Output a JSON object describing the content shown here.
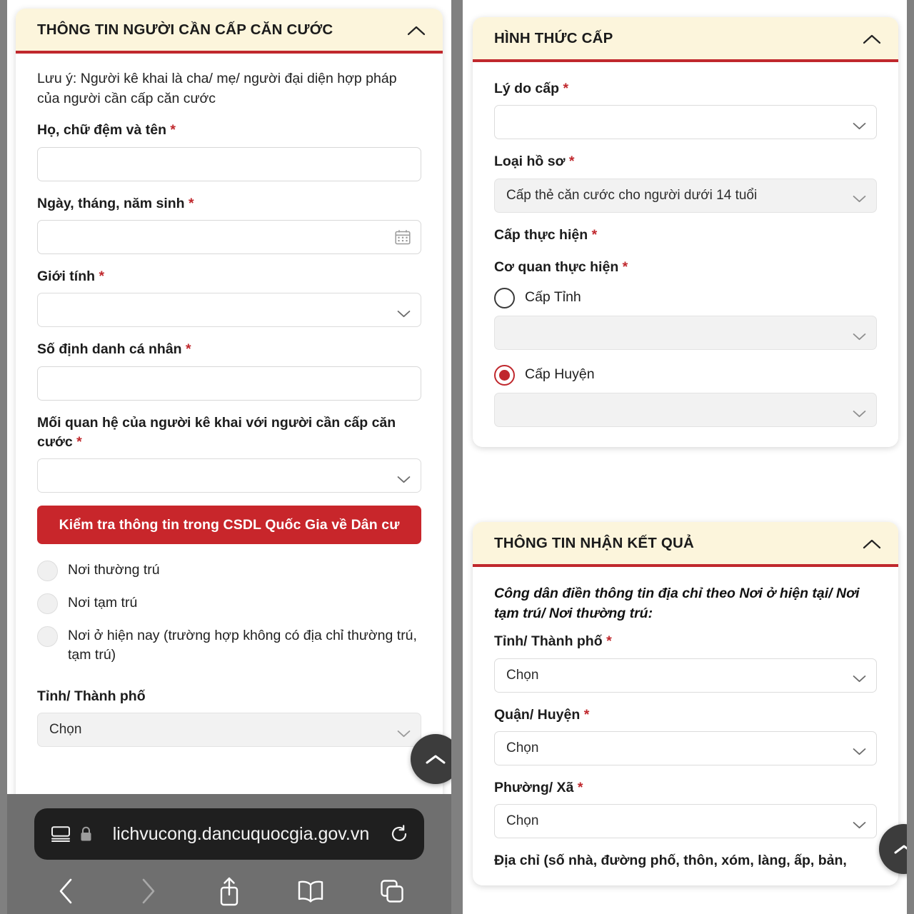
{
  "app": {
    "url": "lichvucong.dancuquocgia.gov.vn",
    "accent_red": "#c0282d",
    "header_cream": "#fcf5dc"
  },
  "left_pane": {
    "card": {
      "title": "THÔNG TIN NGƯỜI CẦN CẤP CĂN CƯỚC",
      "collapse_icon": "chevron-up-icon",
      "note": "Lưu ý: Người kê khai là cha/ mẹ/ người đại diện hợp pháp của người cần cấp căn cước",
      "fields": [
        {
          "label": "Họ, chữ đệm và tên",
          "required": "*",
          "type": "text",
          "value": ""
        },
        {
          "label": "Ngày, tháng, năm sinh",
          "required": "*",
          "type": "date",
          "value": "",
          "icon": "calendar-icon"
        },
        {
          "label": "Giới tính",
          "required": "*",
          "type": "select",
          "value": ""
        },
        {
          "label": "Số định danh cá nhân",
          "required": "*",
          "type": "text",
          "value": ""
        },
        {
          "label": "Mối quan hệ của người kê khai với người cần cấp căn cước",
          "required": "*",
          "type": "select",
          "value": ""
        }
      ],
      "check_button": "Kiểm tra thông tin trong CSDL Quốc Gia về Dân cư",
      "residence_options": [
        {
          "label": "Nơi thường trú",
          "checked": false
        },
        {
          "label": "Nơi tạm trú",
          "checked": false
        },
        {
          "label": "Nơi ở hiện nay (trường hợp không có địa chỉ thường trú, tạm trú)",
          "checked": false
        }
      ],
      "province": {
        "label": "Tỉnh/ Thành phố",
        "required": "",
        "value": "Chọn"
      }
    },
    "fab": {
      "icon": "chevron-up-icon",
      "name": "scroll-to-top"
    }
  },
  "right_pane": {
    "card_issue": {
      "title": "HÌNH THỨC CẤP",
      "collapse_icon": "chevron-up-icon",
      "reason": {
        "label": "Lý do cấp",
        "required": "*",
        "value": ""
      },
      "dossier_type": {
        "label": "Loại hồ sơ",
        "required": "*",
        "value": "Cấp thẻ căn cước cho người dưới 14 tuổi"
      },
      "level_label": {
        "label": "Cấp thực hiện",
        "required": "*"
      },
      "agency_label": {
        "label": "Cơ quan thực hiện",
        "required": "*"
      },
      "agency_options": [
        {
          "label": "Cấp Tỉnh",
          "checked": false,
          "select_value": ""
        },
        {
          "label": "Cấp Huyện",
          "checked": true,
          "select_value": ""
        }
      ]
    },
    "card_result": {
      "title": "THÔNG TIN NHẬN KẾT QUẢ",
      "collapse_icon": "chevron-up-icon",
      "note": "Công dân điền thông tin địa chỉ theo Nơi ở hiện tại/ Nơi tạm trú/ Nơi thường trú:",
      "fields": [
        {
          "label": "Tỉnh/ Thành phố",
          "required": "*",
          "value": "Chọn"
        },
        {
          "label": "Quận/ Huyện",
          "required": "*",
          "value": "Chọn"
        },
        {
          "label": "Phường/ Xã",
          "required": "*",
          "value": "Chọn"
        }
      ],
      "address_label": "Địa chỉ (số nhà, đường phố, thôn, xóm, làng, ấp, bản,"
    },
    "fab": {
      "icon": "chevron-up-icon",
      "name": "scroll-to-top"
    }
  },
  "browser_toolbar": {
    "reader_icon": "reader-view-icon",
    "lock_icon": "lock-icon",
    "reload_icon": "reload-icon",
    "back_icon": "back-chevron-icon",
    "forward_icon": "forward-chevron-icon",
    "share_icon": "share-icon",
    "bookmarks_icon": "book-icon",
    "tabs_icon": "tabs-icon"
  }
}
